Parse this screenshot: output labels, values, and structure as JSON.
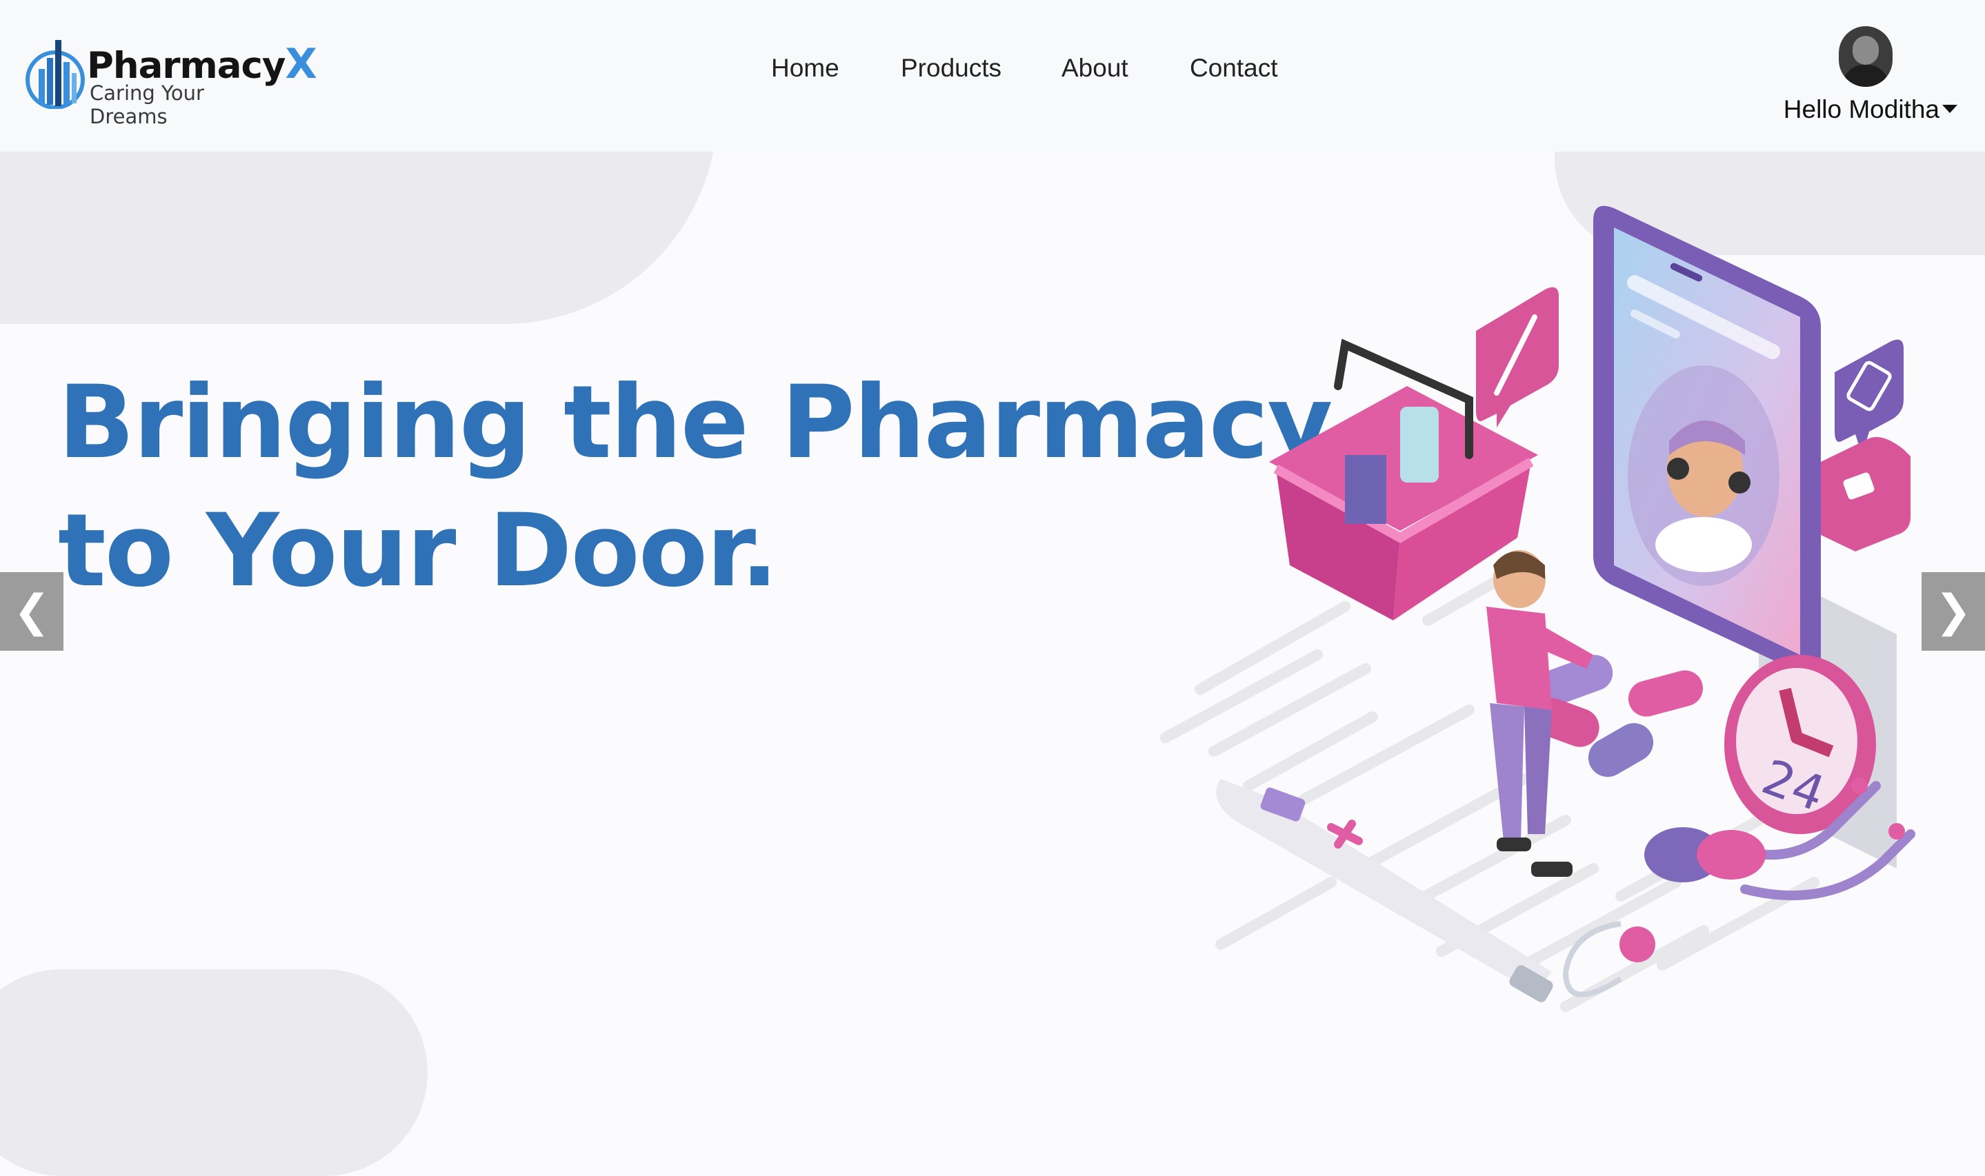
{
  "brand": {
    "name": "Pharmacy",
    "name_accent": "X",
    "tagline": "Caring Your Dreams",
    "accent_color": "#3a8fdd"
  },
  "nav": {
    "links": [
      {
        "label": "Home"
      },
      {
        "label": "Products"
      },
      {
        "label": "About"
      },
      {
        "label": "Contact"
      }
    ]
  },
  "user": {
    "greeting": "Hello Moditha",
    "avatar_icon": "user-avatar",
    "dropdown_icon": "caret-down-icon"
  },
  "hero": {
    "title": "Bringing the Pharmacy\nto Your Door.",
    "title_color": "#3072b8",
    "prev_arrow": "❮",
    "next_arrow": "❯",
    "illustration": "online-pharmacy-illustration"
  },
  "illustration_text": {
    "clock_label": "24"
  }
}
